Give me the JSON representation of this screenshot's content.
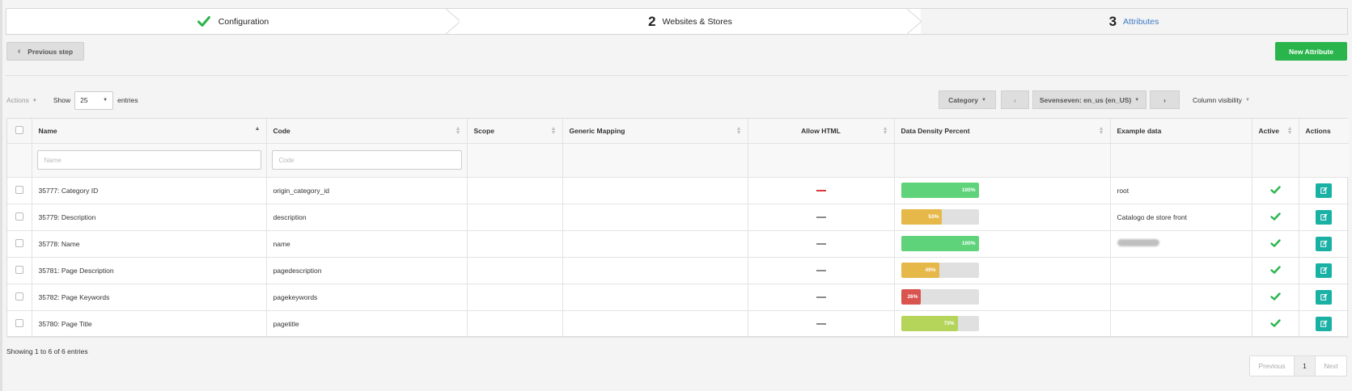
{
  "wizard": {
    "steps": [
      {
        "num": "",
        "label": "Configuration",
        "state": "done"
      },
      {
        "num": "2",
        "label": "Websites & Stores",
        "state": "current"
      },
      {
        "num": "3",
        "label": "Attributes",
        "state": "todo"
      }
    ]
  },
  "buttons": {
    "previous_step": "Previous step",
    "new_attribute": "New Attribute"
  },
  "controls": {
    "actions": "Actions",
    "show": "Show",
    "entries_value": "25",
    "entries": "entries",
    "category": "Category",
    "store": "Sevenseven: en_us (en_US)",
    "column_visibility": "Column visibility"
  },
  "table": {
    "headers": [
      "Name",
      "Code",
      "Scope",
      "Generic Mapping",
      "Allow HTML",
      "Data Density Percent",
      "Example data",
      "Active",
      "Actions"
    ],
    "filters": {
      "name_placeholder": "Name",
      "code_placeholder": "Code"
    },
    "rows": [
      {
        "name": "35777: Category ID",
        "code": "origin_category_id",
        "scope": "",
        "generic_mapping": "",
        "allow_html": "red",
        "density": 100,
        "density_label": "100%",
        "density_color": "#5fd37a",
        "example": "root",
        "example_blurred": false,
        "active": true
      },
      {
        "name": "35779: Description",
        "code": "description",
        "scope": "",
        "generic_mapping": "",
        "allow_html": "gray",
        "density": 53,
        "density_label": "53%",
        "density_color": "#e6b84a",
        "example": "Catalogo de store front",
        "example_blurred": false,
        "active": true
      },
      {
        "name": "35778: Name",
        "code": "name",
        "scope": "",
        "generic_mapping": "",
        "allow_html": "gray",
        "density": 100,
        "density_label": "100%",
        "density_color": "#5fd37a",
        "example": "",
        "example_blurred": true,
        "active": true
      },
      {
        "name": "35781: Page Description",
        "code": "pagedescription",
        "scope": "",
        "generic_mapping": "",
        "allow_html": "gray",
        "density": 49,
        "density_label": "49%",
        "density_color": "#e6b84a",
        "example": "",
        "example_blurred": false,
        "active": true
      },
      {
        "name": "35782: Page Keywords",
        "code": "pagekeywords",
        "scope": "",
        "generic_mapping": "",
        "allow_html": "gray",
        "density": 26,
        "density_label": "26%",
        "density_color": "#d9534f",
        "example": "",
        "example_blurred": false,
        "active": true
      },
      {
        "name": "35780: Page Title",
        "code": "pagetitle",
        "scope": "",
        "generic_mapping": "",
        "allow_html": "gray",
        "density": 73,
        "density_label": "73%",
        "density_color": "#b5d45a",
        "example": "",
        "example_blurred": false,
        "active": true
      }
    ]
  },
  "footer": {
    "info": "Showing 1 to 6 of 6 entries",
    "previous": "Previous",
    "page": "1",
    "next": "Next"
  },
  "colors": {
    "green": "#2ab54c",
    "teal": "#1ab1a5",
    "link_blue": "#3e79c4"
  },
  "icons": {
    "check": "check-icon",
    "chevron_left": "chevron-left-icon",
    "chevron_right": "chevron-right-icon",
    "edit": "edit-icon"
  }
}
